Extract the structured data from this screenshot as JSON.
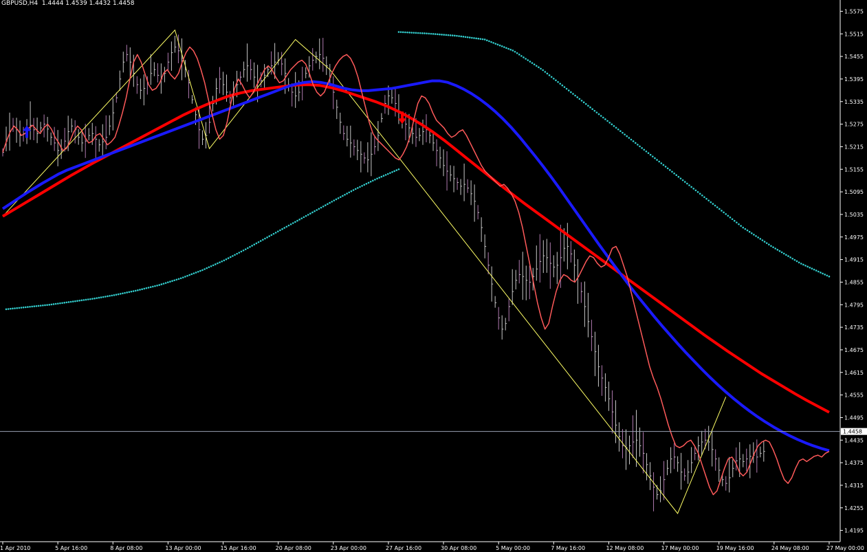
{
  "header": {
    "symbol_label": "GBPUSD,H4",
    "ohlc": "1.4444 1.4539 1.4432 1.4458"
  },
  "colors": {
    "background": "#000000",
    "text": "#ffffff",
    "axis": "#ffffff",
    "ma_fast": "#ff5a5a",
    "ma_mid": "#1a1aff",
    "ma_slow": "#ff0000",
    "envelope": "#33cccc",
    "zigzag": "#ffff66",
    "bars": "#c8c8c8",
    "bars_alt": "#b07ab0",
    "arrow_up": "#1a1aff",
    "arrow_down": "#ff0000",
    "price_line": "#9aa3b5"
  },
  "chart_data": {
    "type": "line",
    "title": "GBPUSD,H4",
    "ylim": [
      1.4165,
      1.5605
    ],
    "y_ticks": [
      "1.5575",
      "1.5515",
      "1.5455",
      "1.5395",
      "1.5335",
      "1.5275",
      "1.5215",
      "1.5155",
      "1.5095",
      "1.5035",
      "1.4975",
      "1.4915",
      "1.4855",
      "1.4795",
      "1.4735",
      "1.4675",
      "1.4615",
      "1.4555",
      "1.4495",
      "1.4435",
      "1.4375",
      "1.4315",
      "1.4255",
      "1.4195"
    ],
    "y_tick_values": [
      1.5575,
      1.5515,
      1.5455,
      1.5395,
      1.5335,
      1.5275,
      1.5215,
      1.5155,
      1.5095,
      1.5035,
      1.4975,
      1.4915,
      1.4855,
      1.4795,
      1.4735,
      1.4675,
      1.4615,
      1.4555,
      1.4495,
      1.4435,
      1.4375,
      1.4315,
      1.4255,
      1.4195
    ],
    "x_ticks": [
      "1 Apr 2010",
      "5 Apr 16:00",
      "8 Apr 08:00",
      "13 Apr 00:00",
      "15 Apr 16:00",
      "20 Apr 08:00",
      "23 Apr 00:00",
      "27 Apr 16:00",
      "30 Apr 08:00",
      "5 May 00:00",
      "7 May 16:00",
      "12 May 08:00",
      "17 May 00:00",
      "19 May 16:00",
      "24 May 08:00",
      "27 May 00:00"
    ],
    "x_tick_index": [
      0,
      16,
      32,
      48,
      64,
      80,
      96,
      112,
      128,
      144,
      160,
      176,
      192,
      208,
      224,
      240
    ],
    "current_price": 1.4458,
    "current_price_label": "1.4458",
    "close_fast": [
      1.52,
      1.523,
      1.5255,
      1.527,
      1.526,
      1.5245,
      1.525,
      1.5265,
      1.5272,
      1.526,
      1.525,
      1.5265,
      1.5275,
      1.5262,
      1.524,
      1.5225,
      1.5205,
      1.521,
      1.523,
      1.5255,
      1.527,
      1.526,
      1.524,
      1.5225,
      1.523,
      1.5245,
      1.525,
      1.5235,
      1.522,
      1.5228,
      1.524,
      1.527,
      1.5305,
      1.5345,
      1.5395,
      1.544,
      1.546,
      1.544,
      1.541,
      1.538,
      1.5365,
      1.537,
      1.5385,
      1.541,
      1.542,
      1.5405,
      1.5395,
      1.541,
      1.544,
      1.5465,
      1.548,
      1.547,
      1.545,
      1.542,
      1.5385,
      1.534,
      1.53,
      1.526,
      1.5235,
      1.5245,
      1.528,
      1.533,
      1.537,
      1.5395,
      1.538,
      1.536,
      1.5345,
      1.536,
      1.538,
      1.54,
      1.542,
      1.543,
      1.542,
      1.54,
      1.5385,
      1.539,
      1.5405,
      1.542,
      1.543,
      1.544,
      1.5445,
      1.5435,
      1.541,
      1.538,
      1.536,
      1.535,
      1.536,
      1.5385,
      1.541,
      1.543,
      1.5445,
      1.5455,
      1.546,
      1.545,
      1.543,
      1.54,
      1.536,
      1.532,
      1.528,
      1.525,
      1.5235,
      1.5225,
      1.5215,
      1.5205,
      1.5195,
      1.5185,
      1.518,
      1.5195,
      1.5215,
      1.5245,
      1.529,
      1.533,
      1.535,
      1.5345,
      1.533,
      1.5305,
      1.5285,
      1.5275,
      1.5265,
      1.525,
      1.524,
      1.5245,
      1.5255,
      1.526,
      1.5245,
      1.5225,
      1.5205,
      1.5185,
      1.5165,
      1.515,
      1.514,
      1.513,
      1.512,
      1.511,
      1.5115,
      1.5105,
      1.509,
      1.507,
      1.504,
      1.5,
      1.495,
      1.49,
      1.485,
      1.48,
      1.476,
      1.473,
      1.4745,
      1.479,
      1.483,
      1.486,
      1.4875,
      1.487,
      1.486,
      1.4855,
      1.487,
      1.489,
      1.491,
      1.4925,
      1.492,
      1.4905,
      1.4895,
      1.49,
      1.492,
      1.4945,
      1.495,
      1.493,
      1.49,
      1.487,
      1.483,
      1.479,
      1.475,
      1.471,
      1.467,
      1.463,
      1.46,
      1.4575,
      1.4545,
      1.451,
      1.4475,
      1.4445,
      1.442,
      1.4415,
      1.442,
      1.443,
      1.4435,
      1.442,
      1.44,
      1.437,
      1.434,
      1.431,
      1.429,
      1.43,
      1.433,
      1.436,
      1.4385,
      1.439,
      1.4375,
      1.435,
      1.434,
      1.435,
      1.4375,
      1.44,
      1.442,
      1.443,
      1.4435,
      1.443,
      1.441,
      1.4385,
      1.4355,
      1.433,
      1.432,
      1.4335,
      1.436,
      1.438,
      1.4385,
      1.4378,
      1.4385,
      1.4392,
      1.4395,
      1.439,
      1.44,
      1.4405
    ],
    "ma_mid": [
      1.505,
      1.5064,
      1.5078,
      1.5092,
      1.5105,
      1.5118,
      1.513,
      1.5142,
      1.5152,
      1.516,
      1.5168,
      1.5176,
      1.5184,
      1.5192,
      1.52,
      1.5208,
      1.5216,
      1.5224,
      1.5232,
      1.524,
      1.5248,
      1.5256,
      1.5264,
      1.5272,
      1.528,
      1.5288,
      1.5296,
      1.5304,
      1.5312,
      1.532,
      1.5328,
      1.5336,
      1.5344,
      1.5352,
      1.536,
      1.5368,
      1.5376,
      1.5382,
      1.5386,
      1.5388,
      1.5386,
      1.5382,
      1.5376,
      1.537,
      1.5366,
      1.5364,
      1.5364,
      1.5366,
      1.5368,
      1.537,
      1.5374,
      1.5378,
      1.5382,
      1.5386,
      1.539,
      1.539,
      1.5386,
      1.5378,
      1.5368,
      1.5356,
      1.5342,
      1.5326,
      1.5308,
      1.5288,
      1.5266,
      1.5242,
      1.5216,
      1.519,
      1.5163,
      1.5135,
      1.5106,
      1.5076,
      1.5046,
      1.5016,
      1.4986,
      1.4956,
      1.4927,
      1.4898,
      1.487,
      1.4842,
      1.4815,
      1.4789,
      1.4763,
      1.4738,
      1.4714,
      1.469,
      1.4667,
      1.4645,
      1.4623,
      1.4602,
      1.4582,
      1.4563,
      1.4545,
      1.4528,
      1.4512,
      1.4497,
      1.4483,
      1.447,
      1.4458,
      1.4447,
      1.4437,
      1.4428,
      1.442,
      1.4413,
      1.4407
    ],
    "ma_slow": [
      1.503,
      1.5048,
      1.5066,
      1.5084,
      1.5102,
      1.512,
      1.5138,
      1.5155,
      1.5172,
      1.5188,
      1.5204,
      1.522,
      1.5236,
      1.5252,
      1.5268,
      1.5284,
      1.53,
      1.5314,
      1.5327,
      1.5339,
      1.535,
      1.5358,
      1.5364,
      1.5368,
      1.5372,
      1.5376,
      1.5379,
      1.538,
      1.5378,
      1.5372,
      1.5364,
      1.5354,
      1.5344,
      1.5334,
      1.5322,
      1.5308,
      1.5292,
      1.5274,
      1.5254,
      1.5232,
      1.5208,
      1.5184,
      1.516,
      1.5136,
      1.5112,
      1.5089,
      1.5066,
      1.5044,
      1.5022,
      1.5,
      1.4978,
      1.4956,
      1.4934,
      1.4912,
      1.489,
      1.4868,
      1.4846,
      1.4824,
      1.4802,
      1.478,
      1.4758,
      1.4736,
      1.4714,
      1.4693,
      1.4672,
      1.4652,
      1.4632,
      1.4612,
      1.4594,
      1.4576,
      1.4558,
      1.4541,
      1.4525,
      1.4509
    ],
    "envelope_lower": [
      1.4783,
      1.4789,
      1.4795,
      1.4803,
      1.4811,
      1.4821,
      1.4833,
      1.4847,
      1.4865,
      1.4887,
      1.4913,
      1.4943,
      1.4975,
      1.5007,
      1.5039,
      1.5071,
      1.5102,
      1.513,
      1.5155
    ],
    "envelope_upper": [
      1.552,
      1.5516,
      1.551,
      1.55,
      1.547,
      1.542,
      1.536,
      1.53,
      1.524,
      1.518,
      1.512,
      1.506,
      1.5,
      1.495,
      1.4905,
      1.487
    ],
    "zigzag": [
      [
        0,
        1.503
      ],
      [
        50,
        1.5525
      ],
      [
        60,
        1.521
      ],
      [
        85,
        1.55
      ],
      [
        95,
        1.542
      ],
      [
        196,
        1.424
      ],
      [
        210,
        1.455
      ]
    ]
  }
}
